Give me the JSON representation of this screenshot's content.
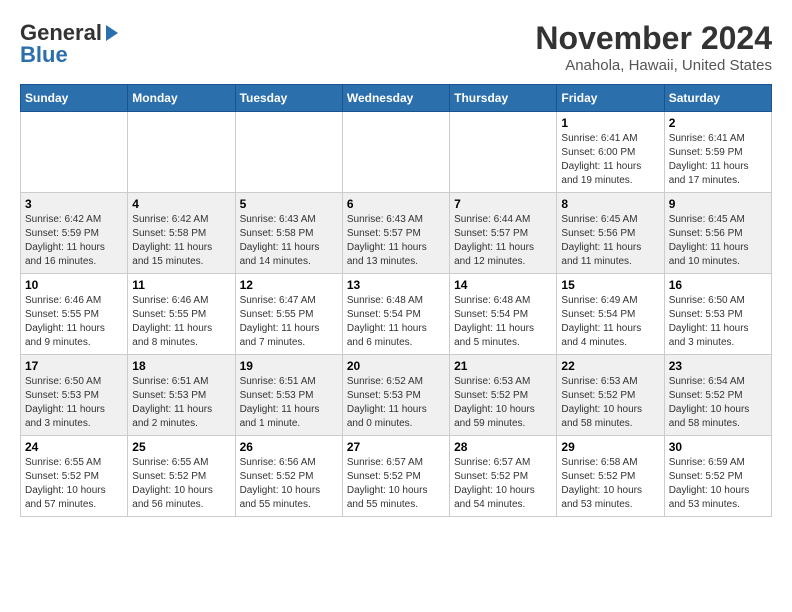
{
  "logo": {
    "general": "General",
    "blue": "Blue"
  },
  "header": {
    "month": "November 2024",
    "location": "Anahola, Hawaii, United States"
  },
  "weekdays": [
    "Sunday",
    "Monday",
    "Tuesday",
    "Wednesday",
    "Thursday",
    "Friday",
    "Saturday"
  ],
  "weeks": [
    [
      {
        "day": "",
        "info": ""
      },
      {
        "day": "",
        "info": ""
      },
      {
        "day": "",
        "info": ""
      },
      {
        "day": "",
        "info": ""
      },
      {
        "day": "",
        "info": ""
      },
      {
        "day": "1",
        "info": "Sunrise: 6:41 AM\nSunset: 6:00 PM\nDaylight: 11 hours and 19 minutes."
      },
      {
        "day": "2",
        "info": "Sunrise: 6:41 AM\nSunset: 5:59 PM\nDaylight: 11 hours and 17 minutes."
      }
    ],
    [
      {
        "day": "3",
        "info": "Sunrise: 6:42 AM\nSunset: 5:59 PM\nDaylight: 11 hours and 16 minutes."
      },
      {
        "day": "4",
        "info": "Sunrise: 6:42 AM\nSunset: 5:58 PM\nDaylight: 11 hours and 15 minutes."
      },
      {
        "day": "5",
        "info": "Sunrise: 6:43 AM\nSunset: 5:58 PM\nDaylight: 11 hours and 14 minutes."
      },
      {
        "day": "6",
        "info": "Sunrise: 6:43 AM\nSunset: 5:57 PM\nDaylight: 11 hours and 13 minutes."
      },
      {
        "day": "7",
        "info": "Sunrise: 6:44 AM\nSunset: 5:57 PM\nDaylight: 11 hours and 12 minutes."
      },
      {
        "day": "8",
        "info": "Sunrise: 6:45 AM\nSunset: 5:56 PM\nDaylight: 11 hours and 11 minutes."
      },
      {
        "day": "9",
        "info": "Sunrise: 6:45 AM\nSunset: 5:56 PM\nDaylight: 11 hours and 10 minutes."
      }
    ],
    [
      {
        "day": "10",
        "info": "Sunrise: 6:46 AM\nSunset: 5:55 PM\nDaylight: 11 hours and 9 minutes."
      },
      {
        "day": "11",
        "info": "Sunrise: 6:46 AM\nSunset: 5:55 PM\nDaylight: 11 hours and 8 minutes."
      },
      {
        "day": "12",
        "info": "Sunrise: 6:47 AM\nSunset: 5:55 PM\nDaylight: 11 hours and 7 minutes."
      },
      {
        "day": "13",
        "info": "Sunrise: 6:48 AM\nSunset: 5:54 PM\nDaylight: 11 hours and 6 minutes."
      },
      {
        "day": "14",
        "info": "Sunrise: 6:48 AM\nSunset: 5:54 PM\nDaylight: 11 hours and 5 minutes."
      },
      {
        "day": "15",
        "info": "Sunrise: 6:49 AM\nSunset: 5:54 PM\nDaylight: 11 hours and 4 minutes."
      },
      {
        "day": "16",
        "info": "Sunrise: 6:50 AM\nSunset: 5:53 PM\nDaylight: 11 hours and 3 minutes."
      }
    ],
    [
      {
        "day": "17",
        "info": "Sunrise: 6:50 AM\nSunset: 5:53 PM\nDaylight: 11 hours and 3 minutes."
      },
      {
        "day": "18",
        "info": "Sunrise: 6:51 AM\nSunset: 5:53 PM\nDaylight: 11 hours and 2 minutes."
      },
      {
        "day": "19",
        "info": "Sunrise: 6:51 AM\nSunset: 5:53 PM\nDaylight: 11 hours and 1 minute."
      },
      {
        "day": "20",
        "info": "Sunrise: 6:52 AM\nSunset: 5:53 PM\nDaylight: 11 hours and 0 minutes."
      },
      {
        "day": "21",
        "info": "Sunrise: 6:53 AM\nSunset: 5:52 PM\nDaylight: 10 hours and 59 minutes."
      },
      {
        "day": "22",
        "info": "Sunrise: 6:53 AM\nSunset: 5:52 PM\nDaylight: 10 hours and 58 minutes."
      },
      {
        "day": "23",
        "info": "Sunrise: 6:54 AM\nSunset: 5:52 PM\nDaylight: 10 hours and 58 minutes."
      }
    ],
    [
      {
        "day": "24",
        "info": "Sunrise: 6:55 AM\nSunset: 5:52 PM\nDaylight: 10 hours and 57 minutes."
      },
      {
        "day": "25",
        "info": "Sunrise: 6:55 AM\nSunset: 5:52 PM\nDaylight: 10 hours and 56 minutes."
      },
      {
        "day": "26",
        "info": "Sunrise: 6:56 AM\nSunset: 5:52 PM\nDaylight: 10 hours and 55 minutes."
      },
      {
        "day": "27",
        "info": "Sunrise: 6:57 AM\nSunset: 5:52 PM\nDaylight: 10 hours and 55 minutes."
      },
      {
        "day": "28",
        "info": "Sunrise: 6:57 AM\nSunset: 5:52 PM\nDaylight: 10 hours and 54 minutes."
      },
      {
        "day": "29",
        "info": "Sunrise: 6:58 AM\nSunset: 5:52 PM\nDaylight: 10 hours and 53 minutes."
      },
      {
        "day": "30",
        "info": "Sunrise: 6:59 AM\nSunset: 5:52 PM\nDaylight: 10 hours and 53 minutes."
      }
    ]
  ]
}
